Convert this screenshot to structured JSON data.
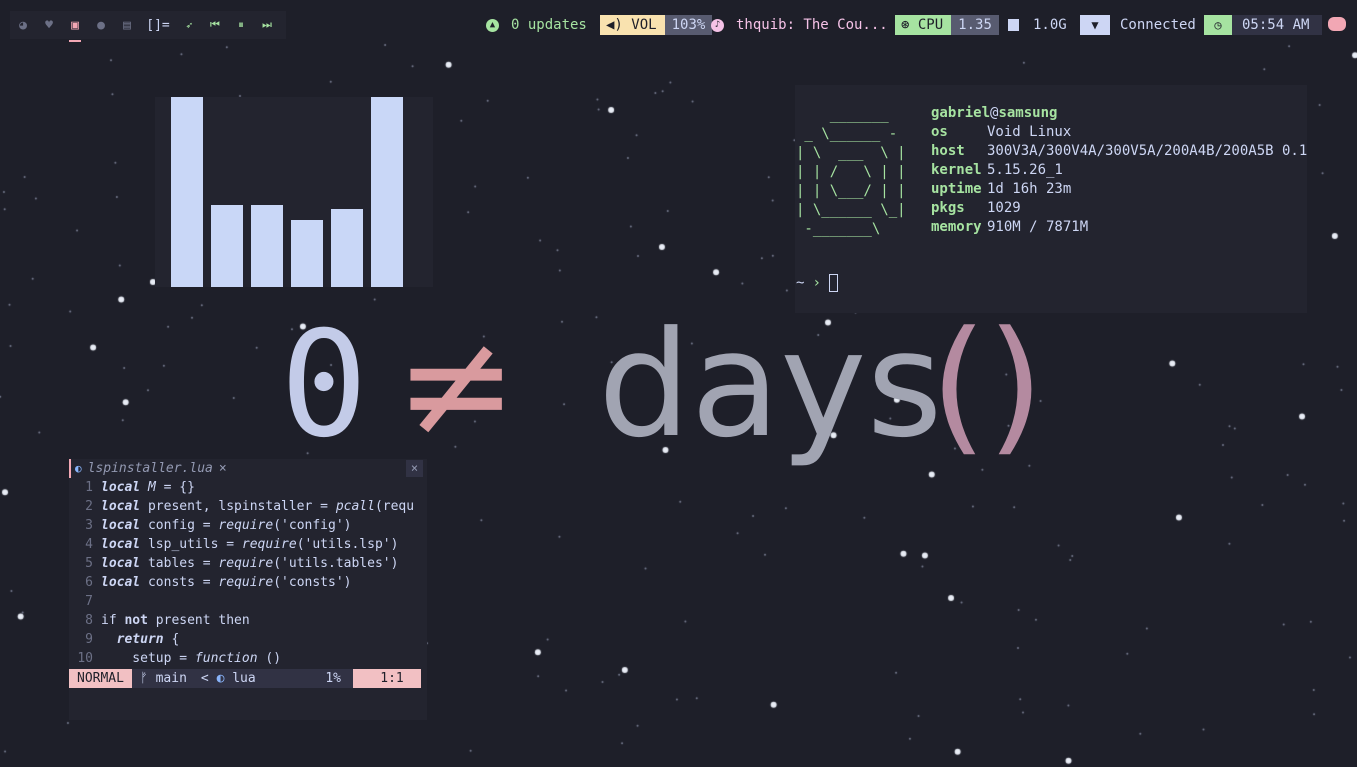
{
  "topbar": {
    "workspace_icons": [
      "firefox-icon",
      "pocket-icon",
      "terminal-icon",
      "spotify-icon",
      "discord-icon"
    ],
    "layout": "[]=",
    "media_icons": [
      "rocket-icon",
      "previous-icon",
      "pause-icon",
      "next-icon"
    ],
    "updates": "0 updates",
    "volume_label": "VOL",
    "volume_value": "103%",
    "now_playing": "thquib: The Cou...",
    "cpu_label": "CPU",
    "cpu_value": "1.35",
    "memory": "1.0G",
    "network": "Connected",
    "clock": "05:54 AM"
  },
  "visualizer": {
    "levels": [
      1.0,
      0.43,
      0.43,
      0.35,
      0.41,
      1.0
    ]
  },
  "fetch": {
    "ascii": "    _______\n _ \\______ -\n| \\  ___  \\ |\n| | /   \\ | |\n| | \\___/ | |\n| \\______ \\_|\n -_______\\",
    "user": "gabriel",
    "at": "@",
    "host": "samsung",
    "rows": [
      {
        "key": "os",
        "value": "Void Linux"
      },
      {
        "key": "host",
        "value": "300V3A/300V4A/300V5A/200A4B/200A5B 0.1"
      },
      {
        "key": "kernel",
        "value": "5.15.26_1"
      },
      {
        "key": "uptime",
        "value": "1d 16h 23m"
      },
      {
        "key": "pkgs",
        "value": "1029"
      },
      {
        "key": "memory",
        "value": "910M / 7871M"
      }
    ],
    "prompt": "~",
    "prompt_arrow": "›"
  },
  "heading": {
    "zero": "0",
    "neq": "≠",
    "days": "days",
    "parens": "()"
  },
  "editor": {
    "filename": "lspinstaller.lua",
    "close": "×",
    "close_all": "×",
    "lines": [
      {
        "n": "1",
        "parts": [
          {
            "c": "kw",
            "t": "local"
          },
          {
            "c": "",
            "t": " "
          },
          {
            "c": "it",
            "t": "M"
          },
          {
            "c": "",
            "t": " = {}"
          }
        ]
      },
      {
        "n": "2",
        "parts": [
          {
            "c": "kw",
            "t": "local"
          },
          {
            "c": "",
            "t": " present, lspinstaller = "
          },
          {
            "c": "it",
            "t": "pcall"
          },
          {
            "c": "",
            "t": "(requ"
          }
        ]
      },
      {
        "n": "3",
        "parts": [
          {
            "c": "kw",
            "t": "local"
          },
          {
            "c": "",
            "t": " config = "
          },
          {
            "c": "it",
            "t": "require"
          },
          {
            "c": "",
            "t": "('config')"
          }
        ]
      },
      {
        "n": "4",
        "parts": [
          {
            "c": "kw",
            "t": "local"
          },
          {
            "c": "",
            "t": " lsp_utils = "
          },
          {
            "c": "it",
            "t": "require"
          },
          {
            "c": "",
            "t": "('utils.lsp')"
          }
        ]
      },
      {
        "n": "5",
        "parts": [
          {
            "c": "kw",
            "t": "local"
          },
          {
            "c": "",
            "t": " tables = "
          },
          {
            "c": "it",
            "t": "require"
          },
          {
            "c": "",
            "t": "('utils.tables')"
          }
        ]
      },
      {
        "n": "6",
        "parts": [
          {
            "c": "kw",
            "t": "local"
          },
          {
            "c": "",
            "t": " consts = "
          },
          {
            "c": "it",
            "t": "require"
          },
          {
            "c": "",
            "t": "('consts')"
          }
        ]
      },
      {
        "n": "7",
        "parts": []
      },
      {
        "n": "8",
        "parts": [
          {
            "c": "",
            "t": "if "
          },
          {
            "c": "kwp",
            "t": "not"
          },
          {
            "c": "",
            "t": " present then"
          }
        ]
      },
      {
        "n": "9",
        "parts": [
          {
            "c": "",
            "t": "  "
          },
          {
            "c": "kw",
            "t": "return"
          },
          {
            "c": "",
            "t": " {"
          }
        ]
      },
      {
        "n": "10",
        "parts": [
          {
            "c": "",
            "t": "    setup = "
          },
          {
            "c": "it",
            "t": "function"
          },
          {
            "c": "",
            "t": " ()"
          }
        ]
      }
    ],
    "status": {
      "mode": "NORMAL",
      "branch": "main",
      "sep": "<",
      "filetype": "lua",
      "percent": "1%",
      "position": "1:1"
    }
  }
}
